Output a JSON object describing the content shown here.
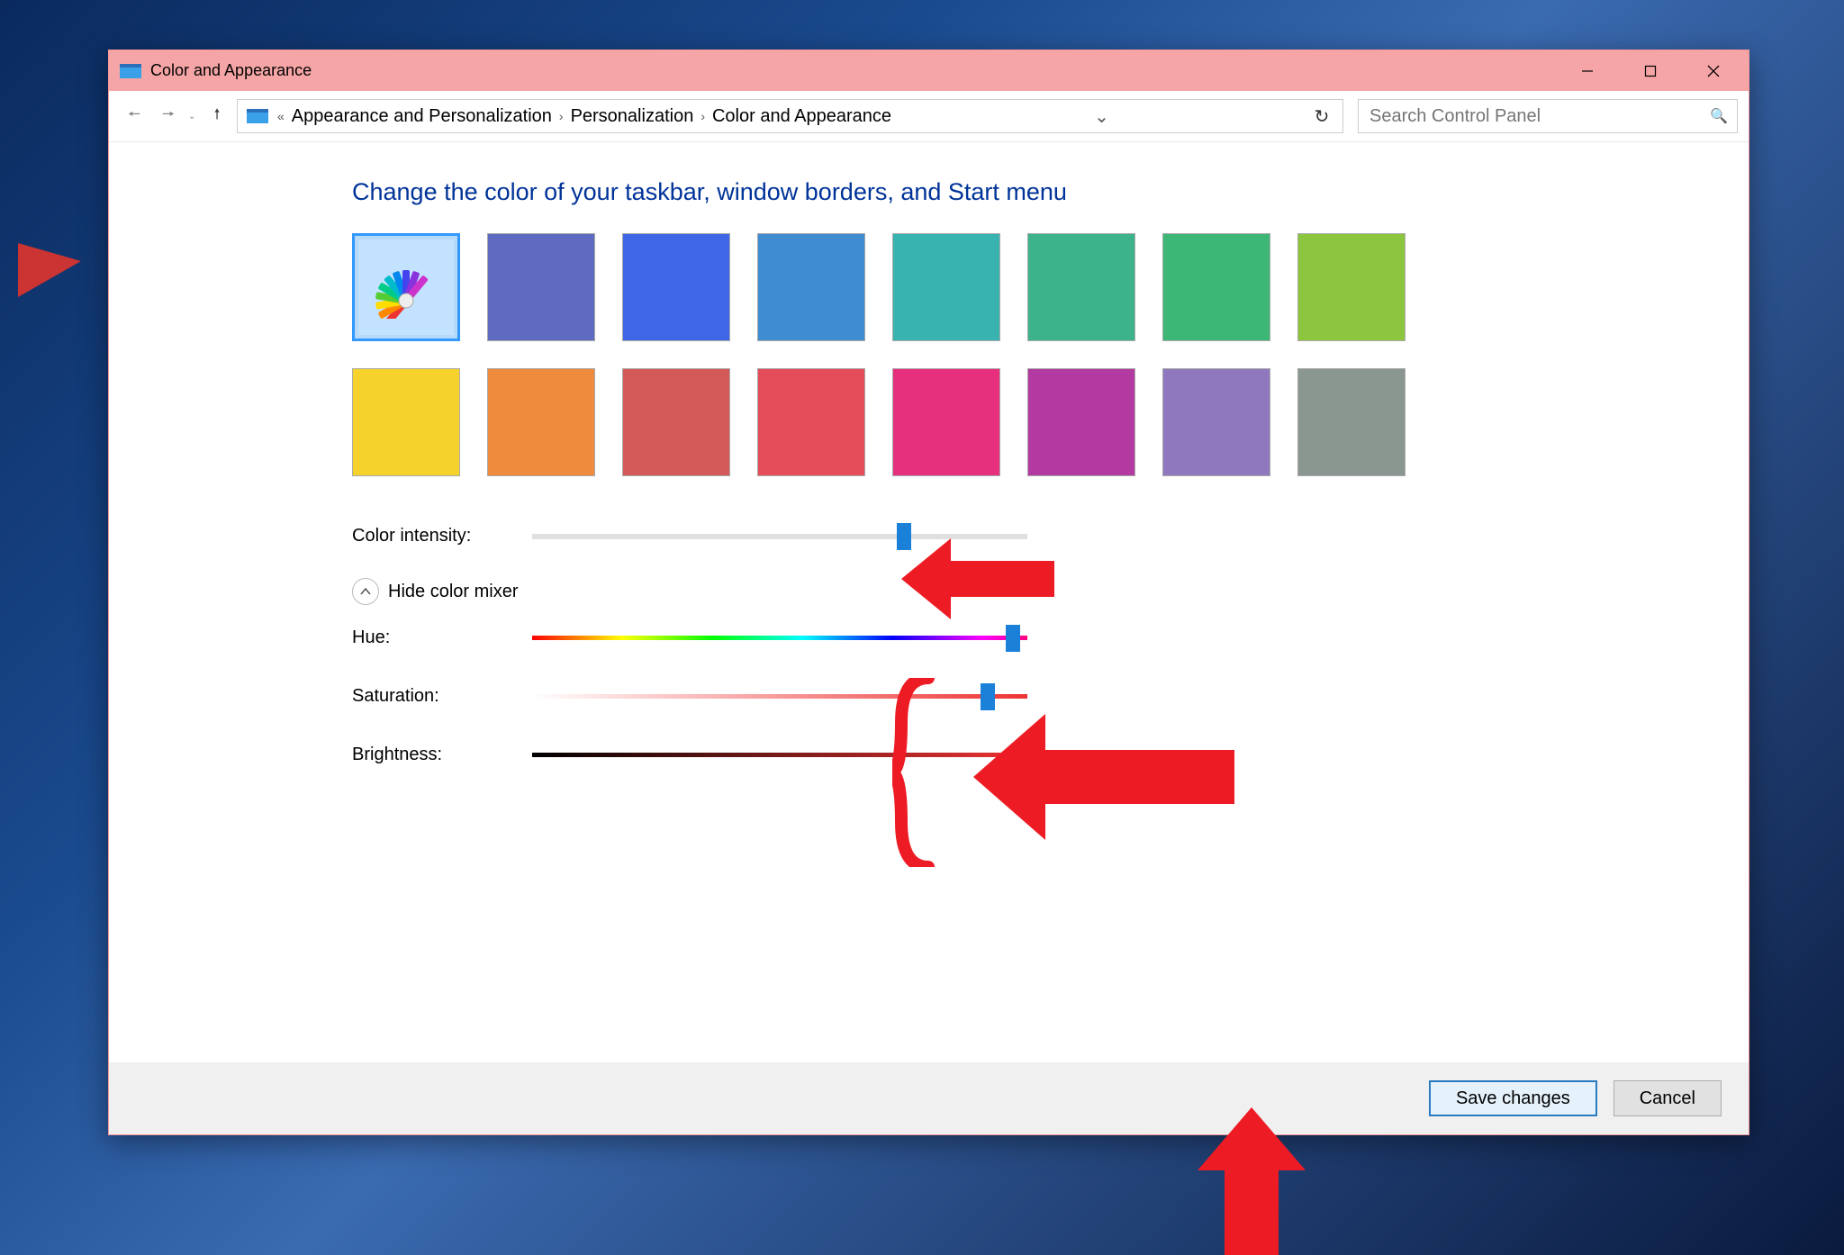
{
  "window": {
    "title": "Color and Appearance"
  },
  "breadcrumb": {
    "ellipsis": "«",
    "items": [
      "Appearance and Personalization",
      "Personalization",
      "Color and Appearance"
    ]
  },
  "search": {
    "placeholder": "Search Control Panel"
  },
  "heading": "Change the color of your taskbar, window borders, and Start menu",
  "swatches": {
    "selected_index": 0,
    "colors": [
      "auto",
      "#5f6ac1",
      "#3f66e6",
      "#3f8cd0",
      "#38b3b0",
      "#3cb38a",
      "#3db775",
      "#8bc63e",
      "#f6d22c",
      "#ef8b3c",
      "#d45a5a",
      "#e34c58",
      "#e6307e",
      "#b23aa0",
      "#8f78bd",
      "#8a9690"
    ]
  },
  "intensity": {
    "label": "Color intensity:",
    "percent": 75
  },
  "mixer_toggle": "Hide color mixer",
  "hue": {
    "label": "Hue:",
    "percent": 97
  },
  "saturation": {
    "label": "Saturation:",
    "percent": 92
  },
  "brightness": {
    "label": "Brightness:",
    "percent": 100
  },
  "buttons": {
    "save": "Save changes",
    "cancel": "Cancel"
  }
}
